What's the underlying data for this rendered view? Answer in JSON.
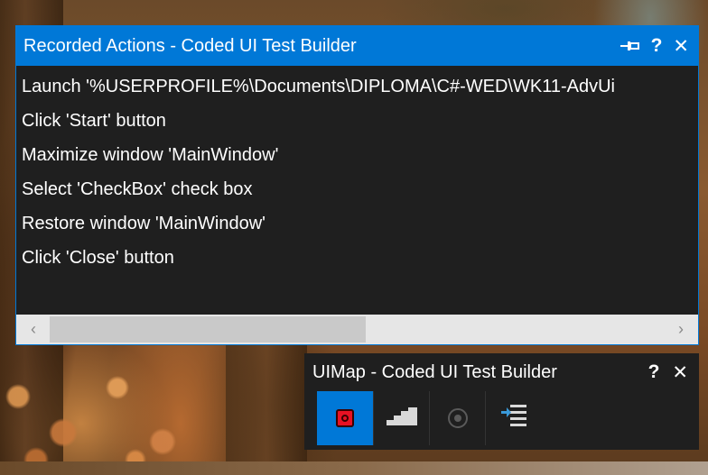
{
  "recorded_actions": {
    "title": "Recorded Actions - Coded UI Test Builder",
    "pin_icon": "pin-icon",
    "help_label": "?",
    "close_label": "✕",
    "actions": [
      "Launch '%USERPROFILE%\\Documents\\DIPLOMA\\C#-WED\\WK11-AdvUi",
      "Click 'Start' button",
      "Maximize window 'MainWindow'",
      "Select 'CheckBox' check box",
      "Restore window 'MainWindow'",
      "Click 'Close' button"
    ],
    "scroll_left": "‹",
    "scroll_right": "›",
    "scroll_position": 0.0
  },
  "uimap": {
    "title": "UIMap - Coded UI Test Builder",
    "help_label": "?",
    "close_label": "✕",
    "tools": [
      {
        "icon": "record-icon",
        "active": true
      },
      {
        "icon": "show-steps-icon",
        "active": false
      },
      {
        "icon": "crosshair-disabled-icon",
        "active": false
      },
      {
        "icon": "generate-code-icon",
        "active": false
      }
    ]
  },
  "colors": {
    "accent": "#0078d7",
    "window_bg": "#1f1f1f",
    "record_red": "#e81123"
  }
}
